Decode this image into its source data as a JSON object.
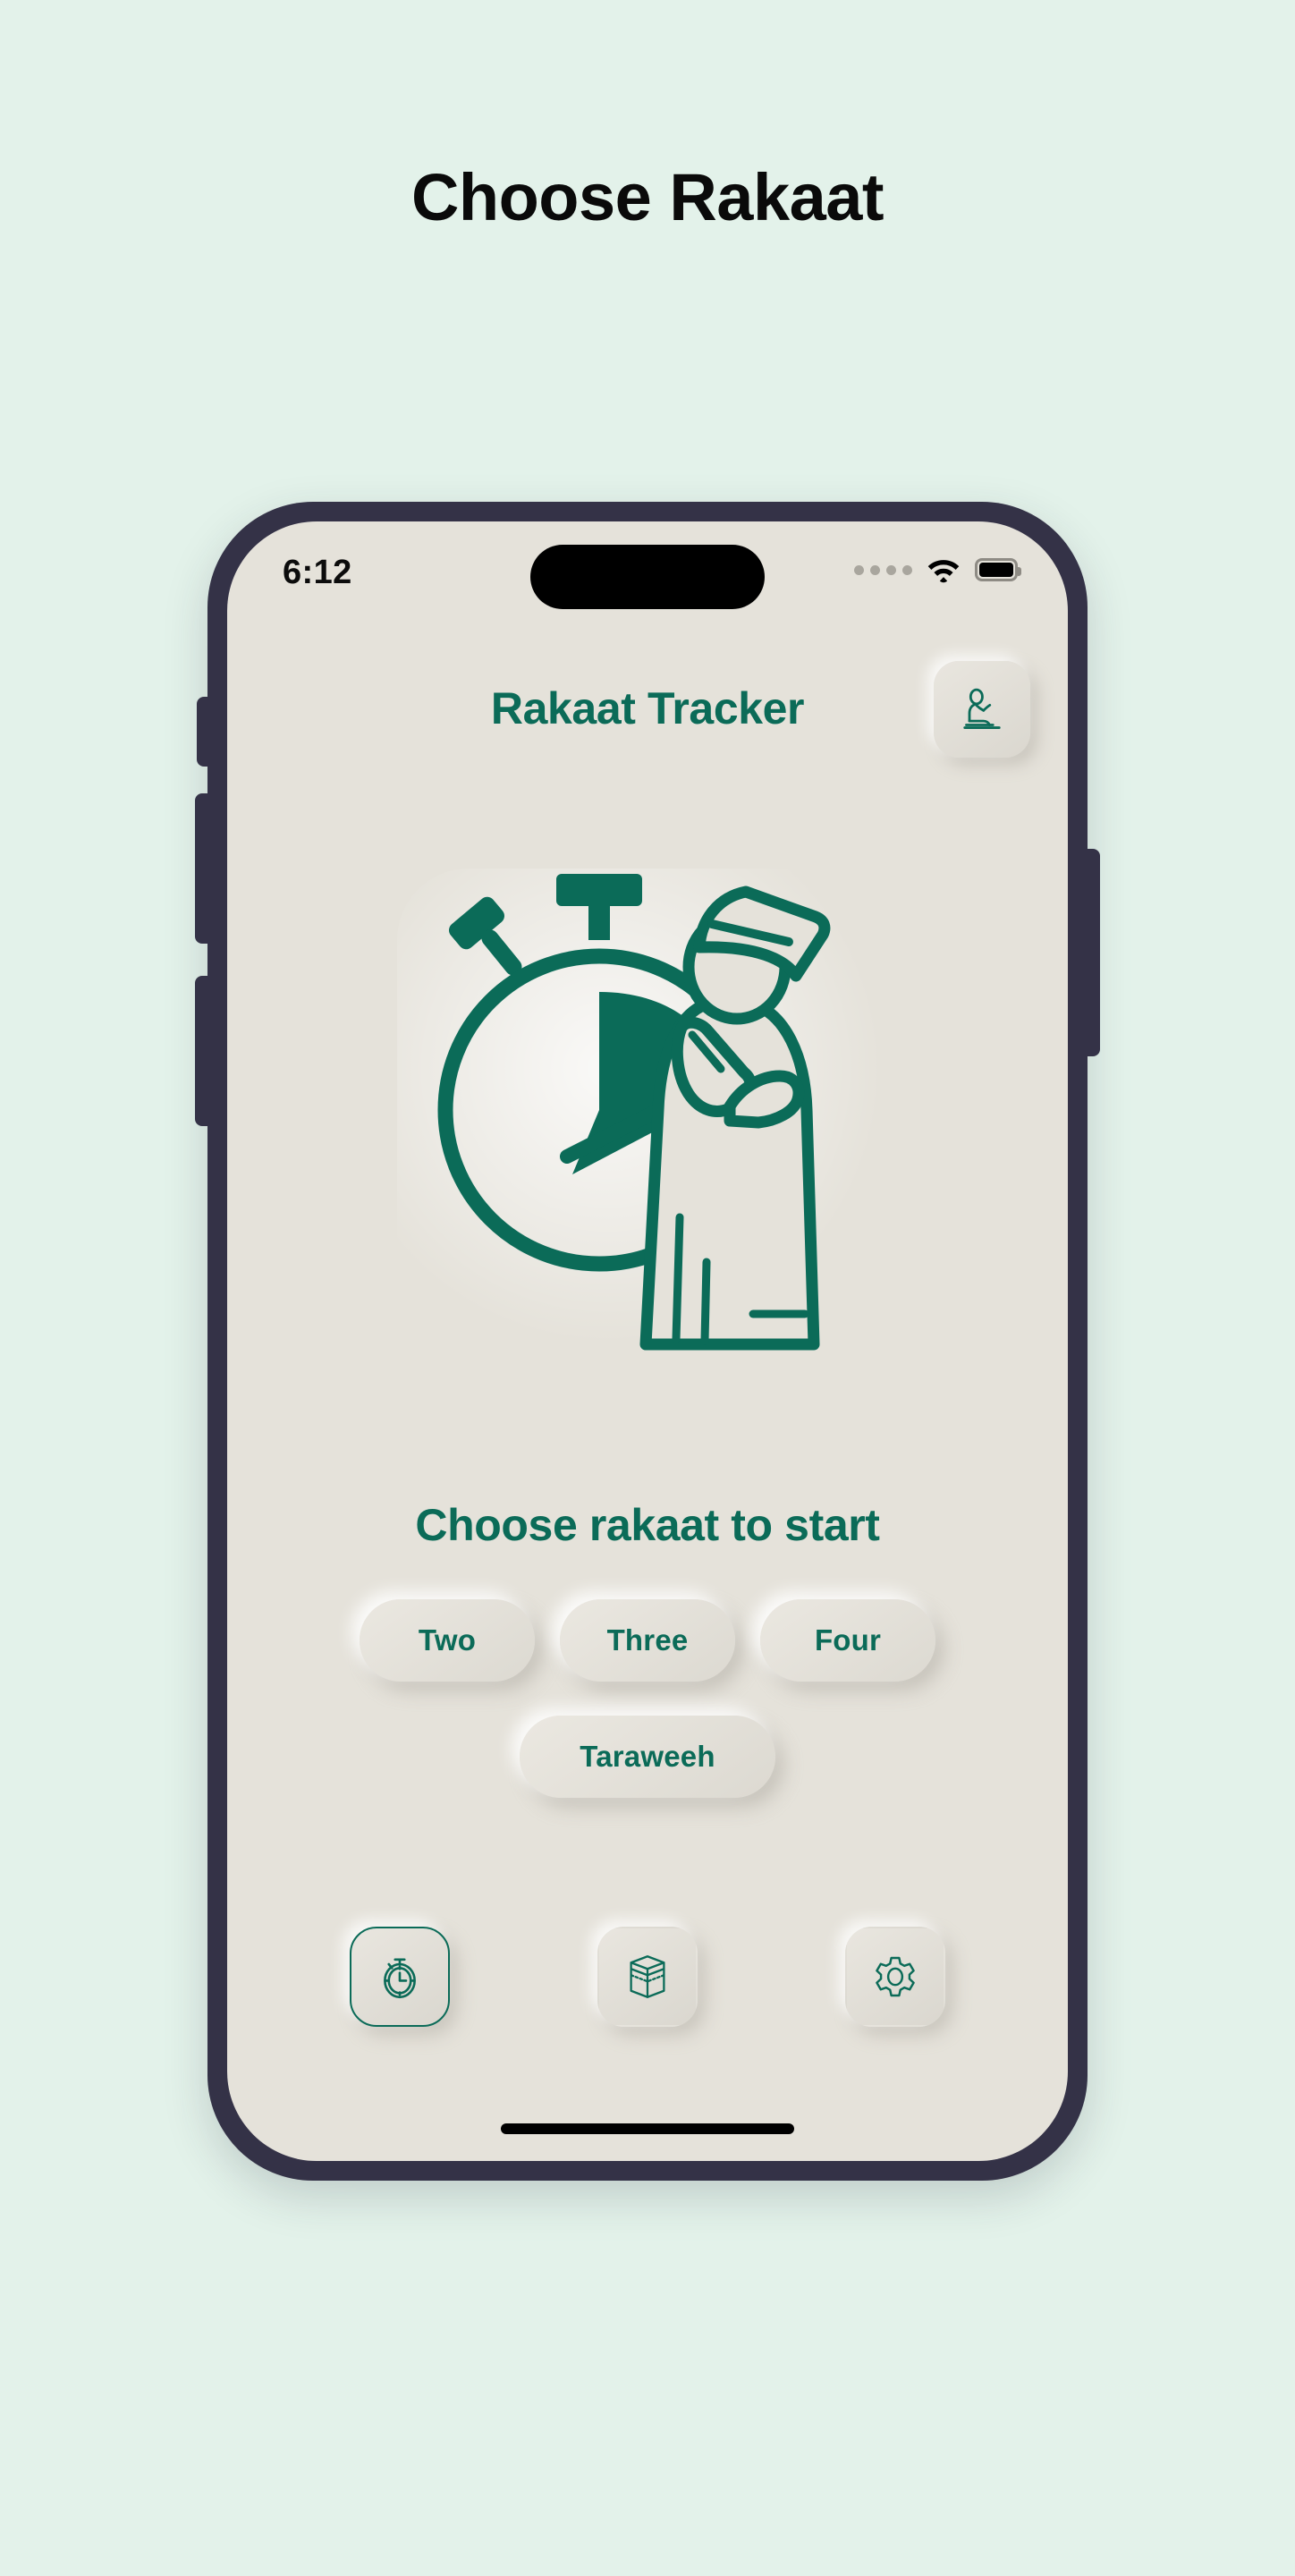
{
  "page": {
    "title": "Choose Rakaat",
    "background_color": "#E3F2EA"
  },
  "theme": {
    "accent": "#0B6B58",
    "screen_bg": "#E5E2DA",
    "frame": "#343247",
    "title_color": "#0A0A0A"
  },
  "device": {
    "status_bar": {
      "time": "6:12",
      "cellular_icon": "signal-dots-icon",
      "wifi_icon": "wifi-icon",
      "battery_icon": "battery-icon"
    },
    "home_indicator": "home-indicator"
  },
  "app": {
    "header": {
      "title": "Rakaat Tracker",
      "action_icon": "praying-person-icon"
    },
    "hero": {
      "illustration": "stopwatch-with-praying-man-icon"
    },
    "section_heading": "Choose rakaat to start",
    "rakaat_rows": [
      [
        {
          "label": "Two",
          "name": "rakaat-two-button"
        },
        {
          "label": "Three",
          "name": "rakaat-three-button"
        },
        {
          "label": "Four",
          "name": "rakaat-four-button"
        }
      ],
      [
        {
          "label": "Taraweeh",
          "name": "rakaat-taraweeh-button"
        }
      ]
    ],
    "bottom_nav": [
      {
        "icon": "stopwatch-icon",
        "name": "nav-tracker",
        "active": true
      },
      {
        "icon": "kaaba-icon",
        "name": "nav-qibla",
        "active": false
      },
      {
        "icon": "gear-icon",
        "name": "nav-settings",
        "active": false
      }
    ]
  }
}
